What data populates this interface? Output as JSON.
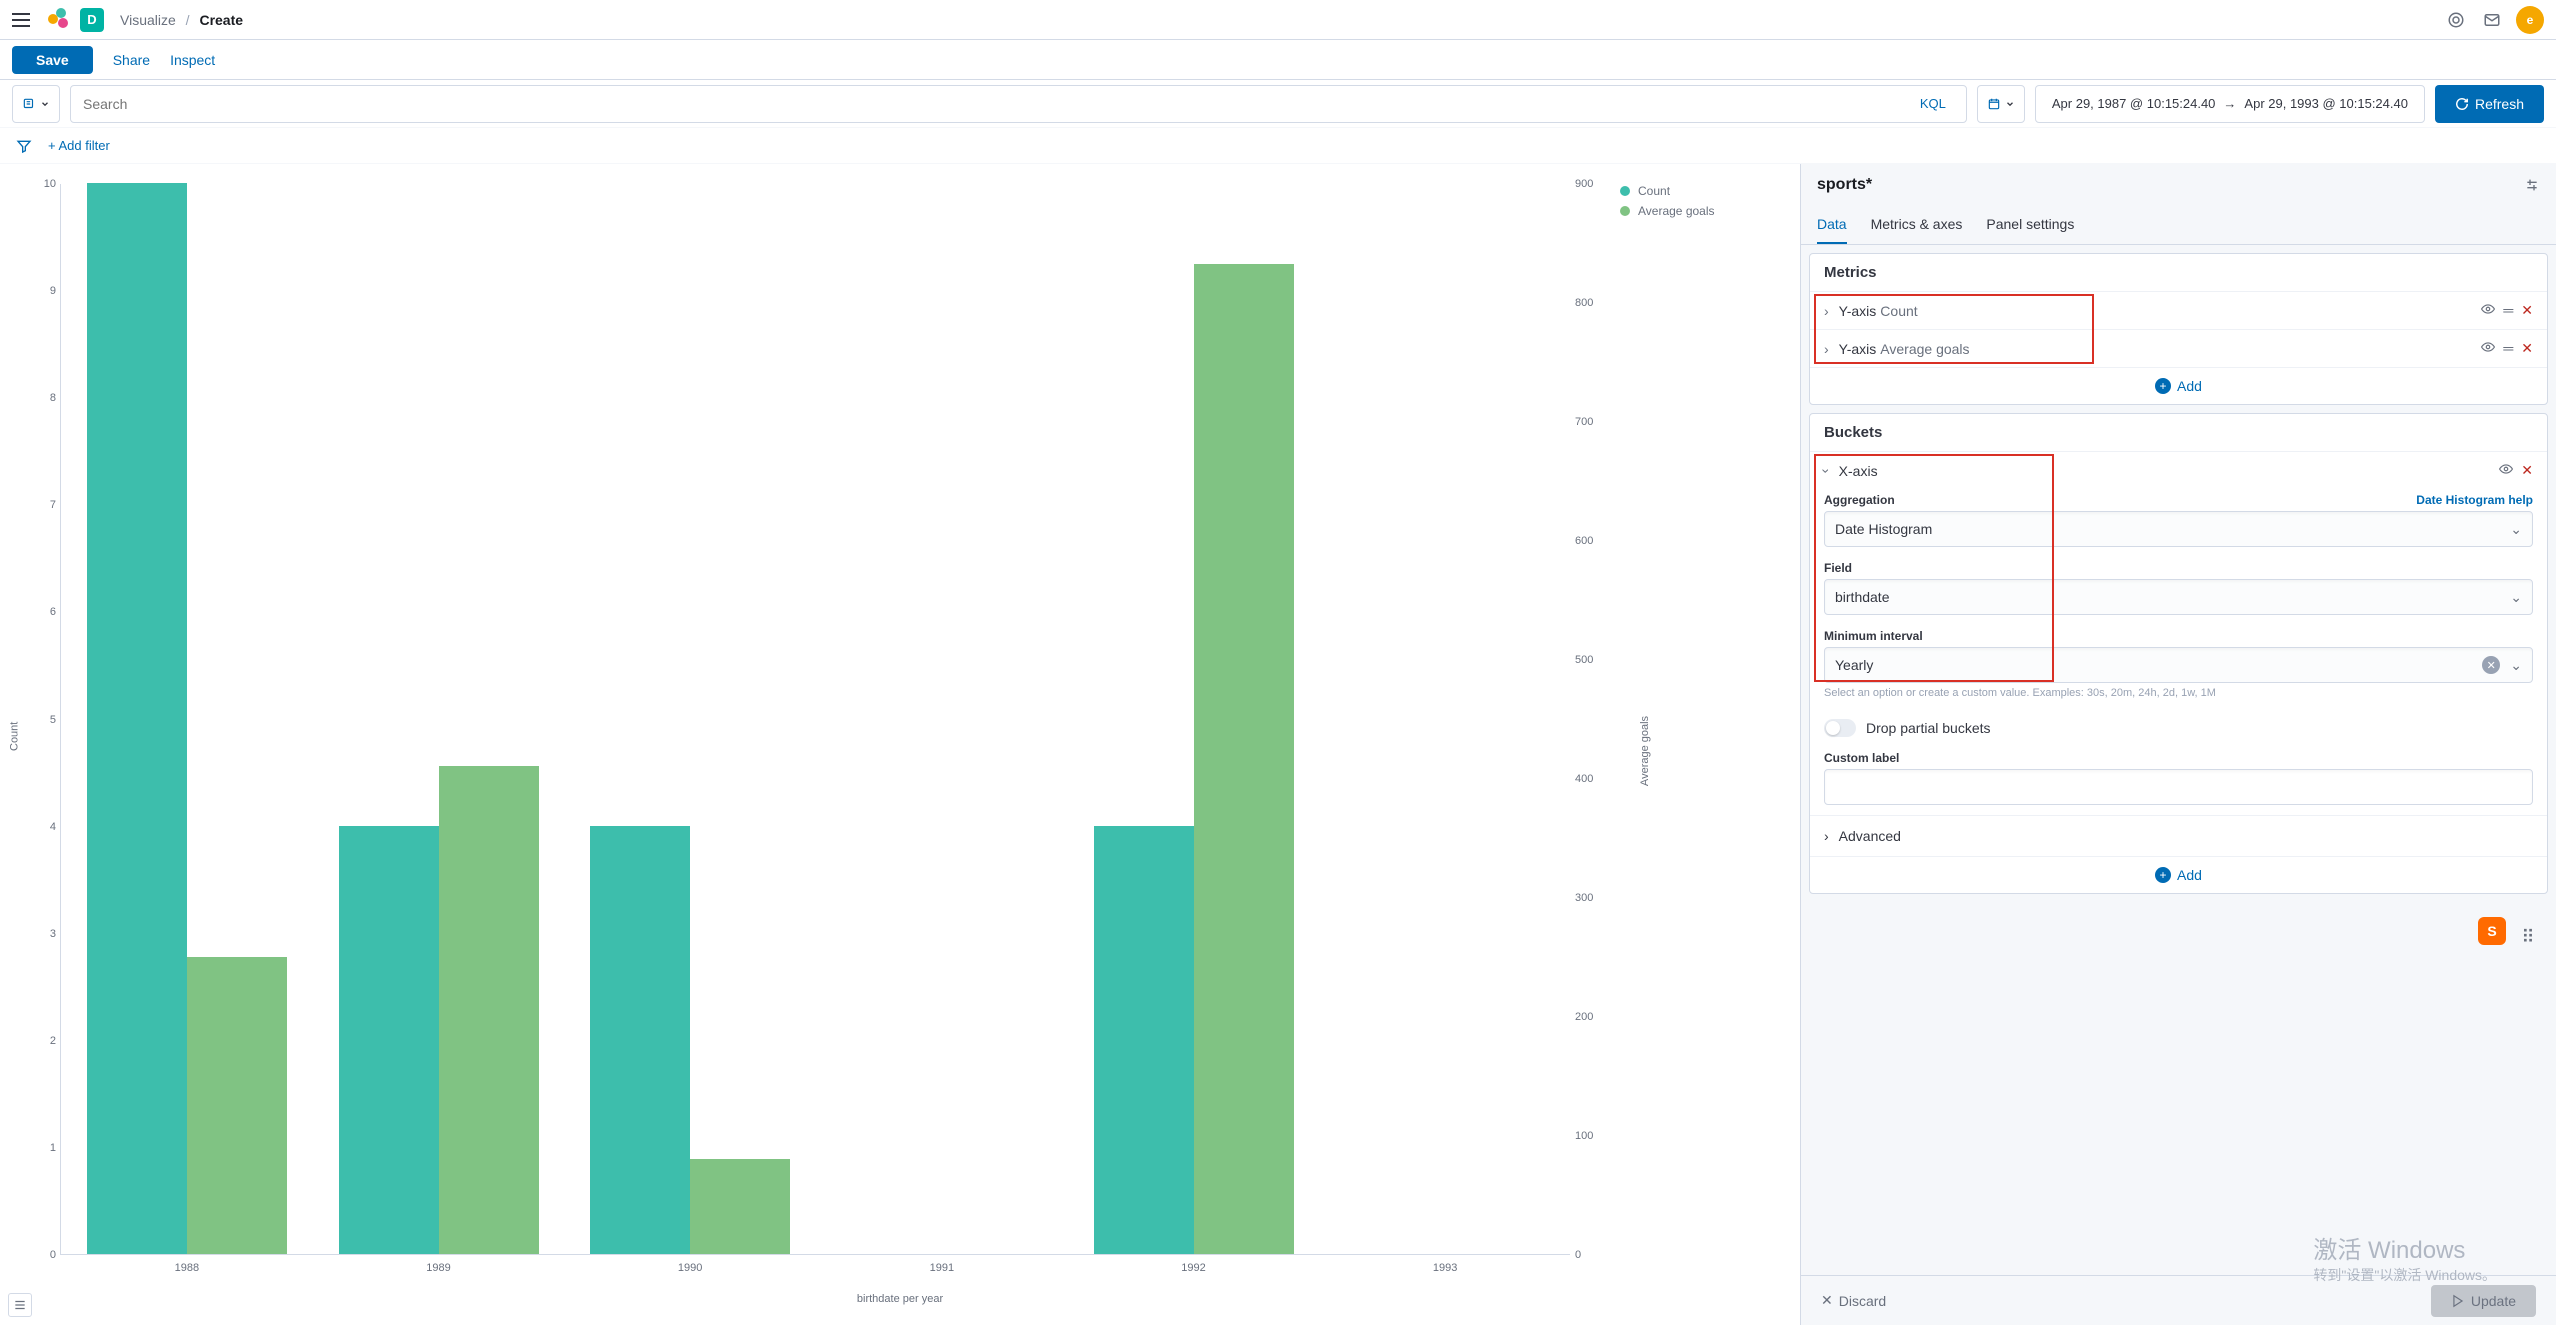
{
  "header": {
    "breadcrumb_root": "Visualize",
    "breadcrumb_current": "Create",
    "badge_letter": "D",
    "avatar_letter": "e"
  },
  "action_bar": {
    "save": "Save",
    "share": "Share",
    "inspect": "Inspect"
  },
  "query_bar": {
    "search_placeholder": "Search",
    "kql": "KQL",
    "date_from": "Apr 29, 1987 @ 10:15:24.40",
    "date_to": "Apr 29, 1993 @ 10:15:24.40",
    "refresh": "Refresh"
  },
  "filter_bar": {
    "add_filter": "+ Add filter"
  },
  "chart_data": {
    "type": "bar",
    "title": "",
    "x_title": "birthdate per year",
    "y_left_label": "Count",
    "y_right_label": "Average goals",
    "y_left_max": 10,
    "y_right_max": 900,
    "y_left_ticks": [
      0,
      1,
      2,
      3,
      4,
      5,
      6,
      7,
      8,
      9,
      10
    ],
    "y_right_ticks": [
      0,
      100,
      200,
      300,
      400,
      500,
      600,
      700,
      800,
      900
    ],
    "categories": [
      "1988",
      "1989",
      "1990",
      "1991",
      "1992",
      "1993"
    ],
    "series": [
      {
        "name": "Count",
        "color": "#3dbeac",
        "axis": "left",
        "values": [
          10,
          4,
          4,
          null,
          4,
          null
        ]
      },
      {
        "name": "Average goals",
        "color": "#80c383",
        "axis": "right",
        "values": [
          250,
          410,
          80,
          null,
          832,
          null
        ]
      }
    ]
  },
  "legend": {
    "items": [
      {
        "label": "Count",
        "color": "#3dbeac"
      },
      {
        "label": "Average goals",
        "color": "#80c383"
      }
    ]
  },
  "panel": {
    "title": "sports*",
    "tabs": [
      "Data",
      "Metrics & axes",
      "Panel settings"
    ],
    "active_tab": 0,
    "metrics": {
      "title": "Metrics",
      "rows": [
        {
          "label": "Y-axis",
          "value": "Count"
        },
        {
          "label": "Y-axis",
          "value": "Average goals"
        }
      ],
      "add": "Add"
    },
    "buckets": {
      "title": "Buckets",
      "row_label": "X-axis",
      "aggregation_label": "Aggregation",
      "aggregation_value": "Date Histogram",
      "help_link": "Date Histogram help",
      "field_label": "Field",
      "field_value": "birthdate",
      "interval_label": "Minimum interval",
      "interval_value": "Yearly",
      "interval_hint": "Select an option or create a custom value. Examples: 30s, 20m, 24h, 2d, 1w, 1M",
      "drop_partial": "Drop partial buckets",
      "custom_label": "Custom label",
      "advanced": "Advanced",
      "add": "Add"
    },
    "footer": {
      "discard": "Discard",
      "update": "Update"
    }
  },
  "watermark": {
    "line1": "激活 Windows",
    "line2": "转到\"设置\"以激活 Windows。"
  },
  "float_badge": "S"
}
